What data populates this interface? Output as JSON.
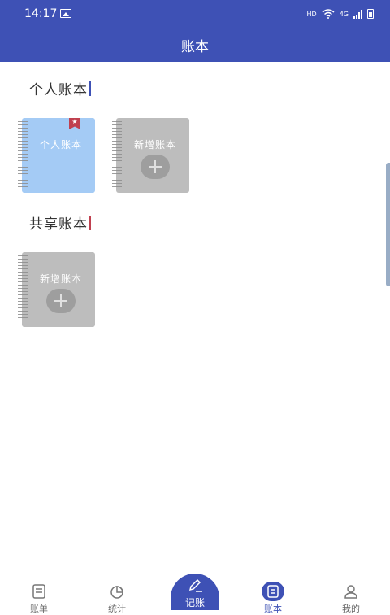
{
  "status_bar": {
    "time": "14:17",
    "network_hd": "HD",
    "network_4g": "4G"
  },
  "app_bar": {
    "title": "账本"
  },
  "sections": {
    "personal": {
      "title": "个人账本",
      "bar_color": "#3e51b5"
    },
    "shared": {
      "title": "共享账本",
      "bar_color": "#c0404f"
    }
  },
  "books": {
    "personal_book": {
      "label": "个人账本",
      "color": "#a4cbf5",
      "bookmark_color": "#c0404f"
    },
    "personal_add": {
      "label": "新增账本"
    },
    "shared_add": {
      "label": "新增账本"
    }
  },
  "bottom_nav": {
    "bills": {
      "label": "账单",
      "icon": "bill-icon"
    },
    "stats": {
      "label": "统计",
      "icon": "pie-chart-icon"
    },
    "record": {
      "label": "记账",
      "icon": "pen-icon"
    },
    "books": {
      "label": "账本",
      "icon": "book-icon",
      "active": true
    },
    "mine": {
      "label": "我的",
      "icon": "user-icon"
    }
  },
  "colors": {
    "primary": "#3e51b5",
    "card_gray": "#bdbdbd"
  }
}
